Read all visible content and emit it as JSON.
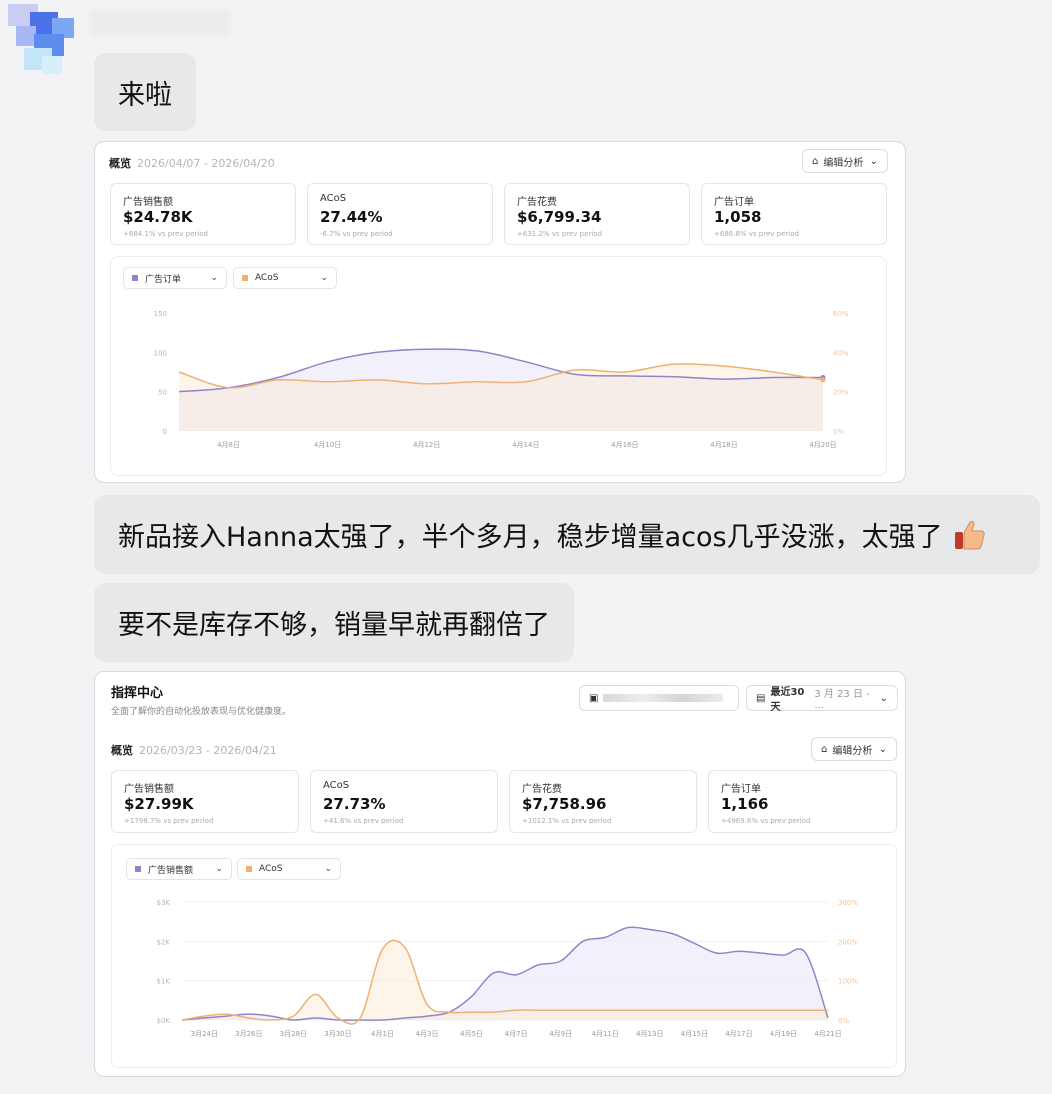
{
  "messages": {
    "m1": "来啦",
    "m2": "新品接入Hanna太强了，半个多月，稳步增量acos几乎没涨，太强了",
    "m3": "要不是库存不够，销量早就再翻倍了"
  },
  "colors": {
    "orders_line": "#8e86c9",
    "acos_line": "#f0b071",
    "area_fill": "#eceaf8",
    "acos_fill": "#fbe9d6"
  },
  "screenshot1": {
    "overview": {
      "title": "概览",
      "date_range": "2026/04/07 - 2026/04/20"
    },
    "edit_button": "编辑分析",
    "kpis": [
      {
        "label": "广告销售额",
        "value": "$24.78K",
        "change": "+684.1% vs prev period"
      },
      {
        "label": "ACoS",
        "value": "27.44%",
        "change": "-6.7% vs prev period"
      },
      {
        "label": "广告花费",
        "value": "$6,799.34",
        "change": "+631.2% vs prev period"
      },
      {
        "label": "广告订单",
        "value": "1,058",
        "change": "+686.8% vs prev period"
      }
    ],
    "selectors": [
      {
        "label": "广告订单"
      },
      {
        "label": "ACoS"
      }
    ],
    "chart_data": {
      "type": "line",
      "x": [
        "4月7日",
        "4月8日",
        "4月9日",
        "4月10日",
        "4月11日",
        "4月12日",
        "4月13日",
        "4月14日",
        "4月15日",
        "4月16日",
        "4月17日",
        "4月18日",
        "4月19日",
        "4月20日"
      ],
      "x_tick_labels": [
        "4月8日",
        "4月10日",
        "4月12日",
        "4月14日",
        "4月16日",
        "4月18日",
        "4月20日"
      ],
      "left_axis": {
        "ticks": [
          "0",
          "50",
          "100",
          "150"
        ],
        "range": [
          0,
          150
        ]
      },
      "right_axis": {
        "ticks": [
          "0%",
          "20%",
          "40%",
          "60%"
        ],
        "range": [
          0,
          60
        ]
      },
      "series": [
        {
          "name": "广告订单",
          "axis": "left",
          "values": [
            50,
            55,
            68,
            88,
            100,
            104,
            102,
            88,
            72,
            70,
            69,
            66,
            68,
            68
          ]
        },
        {
          "name": "ACoS",
          "axis": "right",
          "values": [
            30,
            22,
            26,
            25,
            26,
            24,
            25,
            25,
            31,
            30,
            34,
            33,
            30,
            26
          ]
        }
      ]
    }
  },
  "screenshot2": {
    "header": {
      "title": "指挥中心",
      "subtitle": "全面了解你的自动化投放表现与优化健康度。"
    },
    "date_picker": {
      "label": "最近30天",
      "range": "3 月 23 日 - ..."
    },
    "overview": {
      "title": "概览",
      "date_range": "2026/03/23 - 2026/04/21"
    },
    "edit_button": "编辑分析",
    "kpis": [
      {
        "label": "广告销售额",
        "value": "$27.99K",
        "change": "+1798.7% vs prev period"
      },
      {
        "label": "ACoS",
        "value": "27.73%",
        "change": "+41.6% vs prev period"
      },
      {
        "label": "广告花费",
        "value": "$7,758.96",
        "change": "+1012.1% vs prev period"
      },
      {
        "label": "广告订单",
        "value": "1,166",
        "change": "+4969.6% vs prev period"
      }
    ],
    "selectors": [
      {
        "label": "广告销售额"
      },
      {
        "label": "ACoS"
      }
    ],
    "chart_data": {
      "type": "line",
      "x": [
        "3月23日",
        "3月24日",
        "3月25日",
        "3月26日",
        "3月27日",
        "3月28日",
        "3月29日",
        "3月30日",
        "3月31日",
        "4月1日",
        "4月2日",
        "4月3日",
        "4月4日",
        "4月5日",
        "4月6日",
        "4月7日",
        "4月8日",
        "4月9日",
        "4月10日",
        "4月11日",
        "4月12日",
        "4月13日",
        "4月14日",
        "4月15日",
        "4月16日",
        "4月17日",
        "4月18日",
        "4月19日",
        "4月20日",
        "4月21日"
      ],
      "x_tick_labels": [
        "3月24日",
        "3月26日",
        "3月28日",
        "3月30日",
        "4月1日",
        "4月3日",
        "4月5日",
        "4月7日",
        "4月9日",
        "4月11日",
        "4月13日",
        "4月15日",
        "4月17日",
        "4月19日",
        "4月21日"
      ],
      "left_axis": {
        "ticks": [
          "$0K",
          "$1K",
          "$2K",
          "$3K"
        ],
        "range": [
          0,
          3000
        ]
      },
      "right_axis": {
        "ticks": [
          "0%",
          "100%",
          "200%",
          "300%"
        ],
        "range": [
          0,
          300
        ]
      },
      "series": [
        {
          "name": "广告销售额",
          "axis": "left",
          "values": [
            0,
            50,
            100,
            150,
            100,
            0,
            50,
            0,
            0,
            0,
            50,
            100,
            200,
            600,
            1200,
            1150,
            1400,
            1500,
            2000,
            2100,
            2350,
            2300,
            2200,
            1950,
            1700,
            1750,
            1700,
            1650,
            1700,
            50
          ]
        },
        {
          "name": "ACoS",
          "axis": "right",
          "values": [
            0,
            10,
            15,
            5,
            0,
            10,
            65,
            5,
            5,
            180,
            185,
            40,
            20,
            20,
            20,
            25,
            25,
            25,
            25,
            25,
            25,
            25,
            25,
            25,
            25,
            25,
            25,
            25,
            25,
            25
          ]
        }
      ]
    }
  }
}
